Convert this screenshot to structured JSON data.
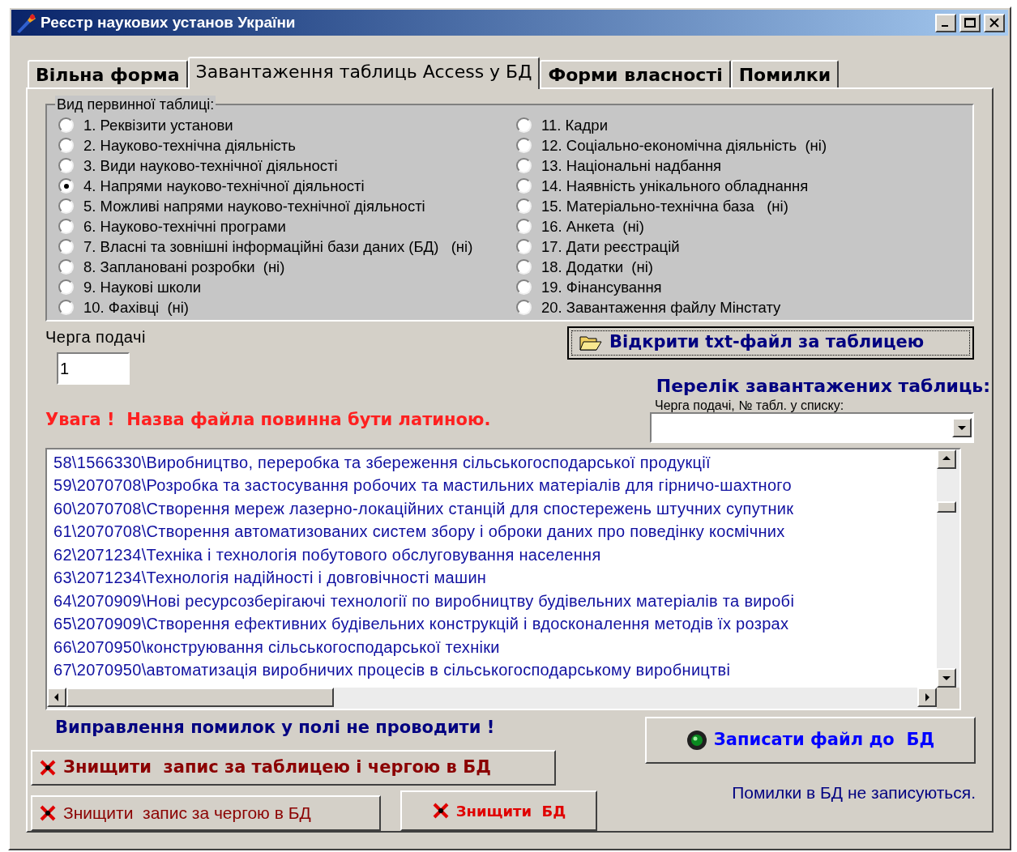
{
  "window": {
    "title": "Реєстр наукових установ України"
  },
  "tabs": [
    {
      "label": "Вільна форма",
      "selected": false
    },
    {
      "label": "Завантаження таблиць Access у БД",
      "selected": true
    },
    {
      "label": "Форми власності",
      "selected": false
    },
    {
      "label": "Помилки",
      "selected": false
    }
  ],
  "table_type": {
    "title": "Вид первинної таблиці:",
    "options": [
      {
        "label": "1. Реквізити установи",
        "selected": false
      },
      {
        "label": "2. Науково-технічна діяльність",
        "selected": false
      },
      {
        "label": "3. Види науково-технічної діяльності",
        "selected": false
      },
      {
        "label": "4. Напрями науково-технічної діяльності",
        "selected": true
      },
      {
        "label": "5. Можливі напрями науково-технічної діяльності",
        "selected": false
      },
      {
        "label": "6. Науково-технічні програми",
        "selected": false
      },
      {
        "label": "7. Власні та зовнішні інформаційні бази даних (БД)   (ні)",
        "selected": false
      },
      {
        "label": "8. Заплановані розробки  (ні)",
        "selected": false
      },
      {
        "label": "9. Наукові школи",
        "selected": false
      },
      {
        "label": "10. Фахівці  (ні)",
        "selected": false
      },
      {
        "label": "11. Кадри",
        "selected": false
      },
      {
        "label": "12. Соціально-економічна діяльність  (ні)",
        "selected": false
      },
      {
        "label": "13. Національні надбання",
        "selected": false
      },
      {
        "label": "14. Наявність унікального обладнання",
        "selected": false
      },
      {
        "label": "15. Матеріально-технічна база   (ні)",
        "selected": false
      },
      {
        "label": "16. Анкета  (ні)",
        "selected": false
      },
      {
        "label": "17. Дати реєстрацій",
        "selected": false
      },
      {
        "label": "18. Додатки  (ні)",
        "selected": false
      },
      {
        "label": "19. Фінансування",
        "selected": false
      },
      {
        "label": "20. Завантаження файлу Мінстату",
        "selected": false
      }
    ]
  },
  "queue": {
    "label": "Черга подачі",
    "value": "1"
  },
  "open_button": {
    "label": "Відкрити txt-файл за таблицею"
  },
  "loaded_tables": {
    "title": "Перелік завантажених таблиць:",
    "dropdown_label": "Черга подачі, № табл. у списку:"
  },
  "warning": "Увага !  Назва файла повинна бути латиною.",
  "rows": [
    "58\\1566330\\Виробництво, переробка та збереження сільськогосподарської продукції",
    "59\\2070708\\Розробка та застосування робочих та мастильних матеріалів для гірничо-шахтного",
    "60\\2070708\\Створення мереж лазерно-локаційних станцій для спостережень штучних супутник",
    "61\\2070708\\Створення автоматизованих систем збору і оброки даних про поведінку космічних",
    "62\\2071234\\Техніка і технологія побутового обслуговування населення",
    "63\\2071234\\Технологія надійності і довговічності машин",
    "64\\2070909\\Нові ресурсозберігаючі технології по виробництву будівельних матеріалів та виробі",
    "65\\2070909\\Створення ефективних будівельних конструкцій і вдосконалення методів їх розрах",
    "66\\2070950\\конструювання сільськогосподарської техніки",
    "67\\2070950\\автоматизація виробничих процесів в сільськогосподарському виробництві"
  ],
  "notice": "Виправлення помилок у полі не проводити !",
  "buttons": [
    {
      "kind": "delete-table-queue",
      "label": "Знищити  запис за таблицею і чергою в БД"
    },
    {
      "kind": "write",
      "label": "Записати файл до  БД"
    },
    {
      "kind": "delete-queue",
      "label": "Знищити  запис за чергою в БД"
    },
    {
      "kind": "delete-db",
      "label": "Знищити  БД"
    }
  ],
  "status_note": "Помилки в БД не записуються."
}
